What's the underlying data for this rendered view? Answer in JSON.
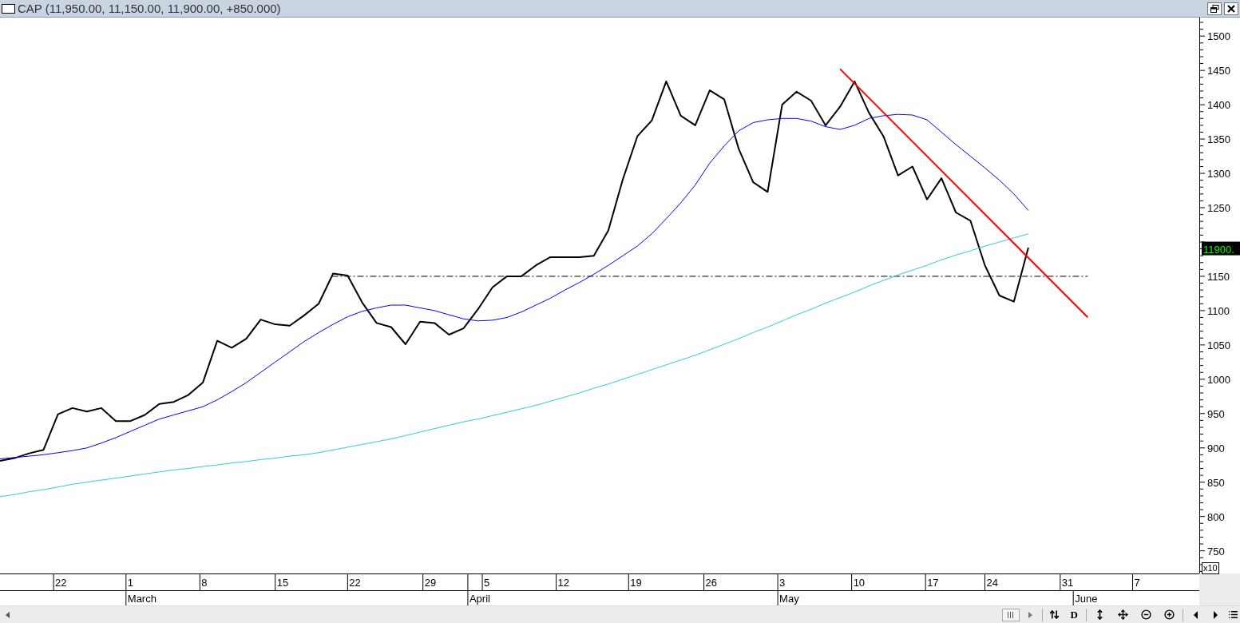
{
  "window": {
    "title": "CAP (11,950.00, 11,150.00, 11,900.00, +850.000)"
  },
  "chart": {
    "chart_data": {
      "type": "line",
      "categories": [
        null,
        null,
        null,
        null,
        null,
        null,
        null,
        null,
        null,
        null,
        null,
        null,
        null,
        null,
        null,
        null,
        null,
        null,
        null,
        null,
        null,
        null,
        null,
        null,
        null,
        null,
        null,
        null,
        null,
        null,
        null,
        null,
        null,
        null,
        null,
        null,
        null,
        null,
        null,
        null,
        null,
        null,
        null,
        null,
        null,
        null,
        null,
        null,
        null,
        null,
        null,
        null,
        null,
        null,
        null,
        null,
        null,
        null,
        null,
        null,
        null,
        null,
        null,
        null,
        null,
        null,
        null,
        null,
        null,
        null,
        null,
        null
      ],
      "series": [
        {
          "color": "#000000",
          "values": [
            881,
            885,
            892,
            897,
            949,
            958,
            953,
            958,
            939,
            939,
            948,
            964,
            967,
            977,
            995,
            1056,
            1046,
            1059,
            1087,
            1080,
            1078,
            1093,
            1110,
            1154,
            1151,
            1112,
            1082,
            1076,
            1051,
            1084,
            1082,
            1065,
            1074,
            1102,
            1134,
            1150,
            1150,
            1166,
            1178,
            1178,
            1178,
            1180,
            1217,
            1291,
            1354,
            1377,
            1434,
            1384,
            1370,
            1421,
            1408,
            1336,
            1287,
            1273,
            1400,
            1419,
            1406,
            1370,
            1397,
            1434,
            1388,
            1354,
            1297,
            1310,
            1262,
            1293,
            1243,
            1231,
            1166,
            1122,
            1113,
            1192
          ]
        },
        {
          "color": "#0000ff",
          "values": [
            884,
            886,
            888,
            890,
            893,
            896,
            900,
            907,
            915,
            924,
            933,
            942,
            948,
            954,
            960,
            970,
            982,
            995,
            1010,
            1025,
            1040,
            1055,
            1068,
            1080,
            1091,
            1099,
            1104,
            1108,
            1108,
            1104,
            1100,
            1094,
            1088,
            1085,
            1086,
            1090,
            1098,
            1108,
            1118,
            1130,
            1141,
            1153,
            1166,
            1180,
            1194,
            1212,
            1234,
            1257,
            1283,
            1315,
            1340,
            1362,
            1374,
            1378,
            1380,
            1380,
            1376,
            1368,
            1364,
            1370,
            1380,
            1384,
            1386,
            1385,
            1378,
            1360,
            1342,
            1325,
            1308,
            1290,
            1270,
            1246
          ]
        },
        {
          "color": "#33cccc",
          "values": [
            829,
            832,
            836,
            839,
            843,
            847,
            850,
            853,
            856,
            859,
            862,
            865,
            868,
            870,
            873,
            875,
            878,
            880,
            883,
            885,
            888,
            890,
            893,
            897,
            901,
            905,
            909,
            913,
            918,
            923,
            928,
            933,
            938,
            942,
            947,
            952,
            957,
            962,
            968,
            974,
            980,
            987,
            993,
            1000,
            1007,
            1014,
            1021,
            1028,
            1035,
            1043,
            1051,
            1059,
            1068,
            1076,
            1085,
            1094,
            1102,
            1111,
            1119,
            1127,
            1136,
            1144,
            1152,
            1159,
            1166,
            1174,
            1181,
            1187,
            1194,
            1200,
            1206,
            1212
          ]
        },
        {
          "color": "#ff0000",
          "values": [
            null,
            null,
            null,
            null,
            null,
            null,
            null,
            null,
            null,
            null,
            null,
            null,
            null,
            null,
            null,
            null,
            null,
            null,
            null,
            null,
            null,
            null,
            null,
            null,
            null,
            null,
            null,
            null,
            null,
            null,
            null,
            null,
            null,
            null,
            null,
            null,
            null,
            null,
            null,
            null,
            null,
            null,
            null,
            null,
            null,
            null,
            null,
            null,
            null,
            null,
            null,
            null,
            null,
            null,
            null,
            null,
            null,
            null,
            1452,
            null,
            null,
            null,
            null,
            null,
            null,
            null,
            null,
            null,
            null,
            null,
            null,
            1177
          ]
        }
      ],
      "ylim": [
        717,
        1527
      ],
      "yticks": [
        750,
        800,
        850,
        900,
        950,
        1000,
        1050,
        1100,
        1150,
        1250,
        1300,
        1350,
        1400,
        1450,
        1500
      ]
    },
    "date_axis": [
      "22",
      "1",
      "8",
      "15",
      "22",
      "29",
      "5",
      "12",
      "19",
      "26",
      "3",
      "10",
      "17",
      "24",
      "31",
      "7"
    ],
    "price_tag": "11900.",
    "months": [
      "March",
      "April",
      "May",
      "June"
    ],
    "scale_label": "x10"
  },
  "toolbar": {
    "letter_button": "D"
  }
}
